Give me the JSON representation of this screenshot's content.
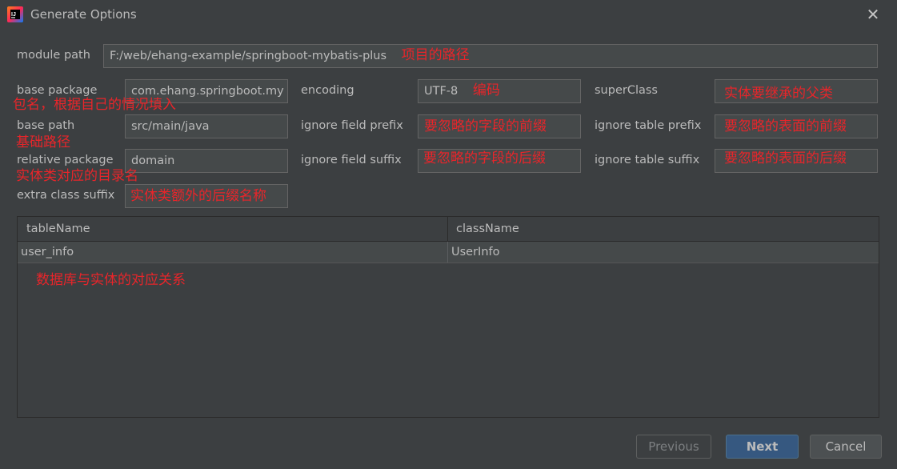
{
  "window": {
    "title": "Generate Options"
  },
  "form": {
    "module_path": {
      "label": "module path",
      "value": "F:/web/ehang-example/springboot-mybatis-plus",
      "note": "项目的路径"
    },
    "base_package": {
      "label": "base package",
      "value": "com.ehang.springboot.my",
      "note": "包名，根据自己的情况填入"
    },
    "base_path": {
      "label": "base path",
      "value": "src/main/java",
      "note": "基础路径"
    },
    "relative_package": {
      "label": "relative package",
      "value": "domain",
      "note": "实体类对应的目录名"
    },
    "extra_class_suffix": {
      "label": "extra class suffix",
      "value": "",
      "note": "实体类额外的后缀名称"
    },
    "encoding": {
      "label": "encoding",
      "value": "UTF-8",
      "note": "编码"
    },
    "ignore_field_prefix": {
      "label": "ignore field prefix",
      "value": "",
      "note": "要忽略的字段的前缀"
    },
    "ignore_field_suffix": {
      "label": "ignore field suffix",
      "value": "",
      "note": "要忽略的字段的后缀"
    },
    "super_class": {
      "label": "superClass",
      "value": "",
      "note": "实体要继承的父类"
    },
    "ignore_table_prefix": {
      "label": "ignore table prefix",
      "value": "",
      "note": "要忽略的表面的前缀"
    },
    "ignore_table_suffix": {
      "label": "ignore table suffix",
      "value": "",
      "note": "要忽略的表面的后缀"
    }
  },
  "table": {
    "columns": [
      "tableName",
      "className"
    ],
    "rows": [
      [
        "user_info",
        "UserInfo"
      ]
    ],
    "note": "数据库与实体的对应关系"
  },
  "buttons": {
    "previous": "Previous",
    "next": "Next",
    "cancel": "Cancel"
  },
  "colors": {
    "background": "#3c3f41",
    "field": "#45494a",
    "annotation": "#e8252a",
    "primary_button": "#365880"
  }
}
